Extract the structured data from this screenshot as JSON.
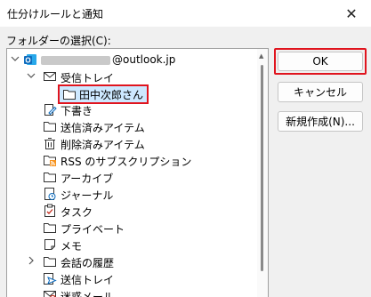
{
  "dialog": {
    "title": "仕分けルールと通知",
    "close_symbol": "✕",
    "folder_label": "フォルダーの選択(C):"
  },
  "tree": {
    "account_suffix": "@outlook.jp",
    "inbox": "受信トレイ",
    "selected_folder": "田中次郎さん",
    "drafts": "下書き",
    "sent": "送信済みアイテム",
    "deleted": "削除済みアイテム",
    "rss": "RSS のサブスクリプション",
    "archive": "アーカイブ",
    "journal": "ジャーナル",
    "tasks": "タスク",
    "private": "プライベート",
    "notes": "メモ",
    "conversation_history": "会話の履歴",
    "outbox": "送信トレイ",
    "junk": "迷惑メール"
  },
  "buttons": {
    "ok": "OK",
    "cancel": "キャンセル",
    "new": "新規作成(N)..."
  },
  "colors": {
    "highlight_outline": "#e0141e",
    "selection_fill": "#cde8ff",
    "outlook_blue": "#0f6cbd"
  }
}
